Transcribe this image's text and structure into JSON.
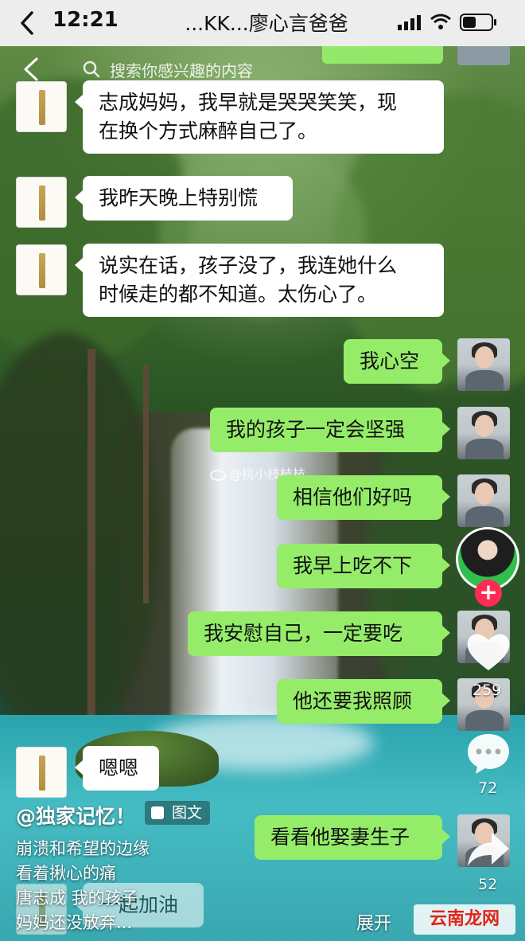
{
  "status_bar": {
    "time": "12:21",
    "chat_title": "...KK...廖心言爸爸"
  },
  "video_overlay": {
    "search_placeholder": "搜索你感兴趣的内容"
  },
  "messages": [
    {
      "side": "left",
      "lines": [
        "志成妈妈，我早就是哭哭笑笑，现",
        "在换个方式麻醉自己了。"
      ]
    },
    {
      "side": "left",
      "lines": [
        "我昨天晚上特别慌"
      ]
    },
    {
      "side": "left",
      "lines": [
        "说实在话，孩子没了，我连她什么",
        "时候走的都不知道。太伤心了。"
      ]
    },
    {
      "side": "right",
      "lines": [
        "我心空"
      ]
    },
    {
      "side": "right",
      "lines": [
        "我的孩子一定会坚强"
      ]
    },
    {
      "side": "right",
      "lines": [
        "相信他们好吗"
      ]
    },
    {
      "side": "right",
      "lines": [
        "我早上吃不下"
      ]
    },
    {
      "side": "right",
      "lines": [
        "我安慰自己，一定要吃"
      ]
    },
    {
      "side": "right",
      "lines": [
        "他还要我照顾"
      ]
    },
    {
      "side": "left",
      "lines": [
        "嗯嗯"
      ]
    },
    {
      "side": "right",
      "lines": [
        "看看他娶妻生子"
      ]
    },
    {
      "side": "left",
      "lines": [
        "一起加油"
      ]
    }
  ],
  "watermark": "@桃小枝枝枝",
  "actions": {
    "follow_label": "+",
    "like_count": "259",
    "comment_count": "72",
    "share_count": "52"
  },
  "post": {
    "author": "@独家记忆！",
    "tag": "图文",
    "caption_lines": [
      "崩溃和希望的边缘",
      "看着揪心的痛",
      "唐志成 我的孩子",
      "妈妈还没放弃..."
    ],
    "expand_label": "展开"
  },
  "site_logo": "云南龙网",
  "colors": {
    "status_bar_bg": "#ededed",
    "bubble_right": "#95ec69",
    "bubble_left": "#ffffff",
    "follow_button": "#fe2c55"
  }
}
